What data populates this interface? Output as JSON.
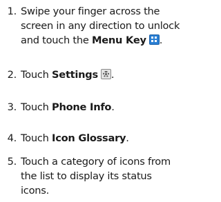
{
  "steps": [
    {
      "number": "1.",
      "line1": "Swipe your finger across the",
      "line2": "screen in any direction to unlock",
      "line3_text": "and touch the ",
      "line3_bold": "Menu Key",
      "line3_end": ".",
      "icon": "menu-key-icon"
    },
    {
      "number": "2.",
      "text": "Touch ",
      "bold": "Settings",
      "end": ".",
      "icon": "settings-icon"
    },
    {
      "number": "3.",
      "text": "Touch ",
      "bold": "Phone Info",
      "end": "."
    },
    {
      "number": "4.",
      "text": "Touch ",
      "bold": "Icon Glossary",
      "end": "."
    },
    {
      "number": "5.",
      "line1": "Touch a category of icons from",
      "line2": "the list to display its status",
      "line3": "icons."
    }
  ],
  "colors": {
    "text": "#1a1a1a",
    "menu_icon": "#2a7fd4",
    "settings_icon": "#e2e2e2"
  }
}
